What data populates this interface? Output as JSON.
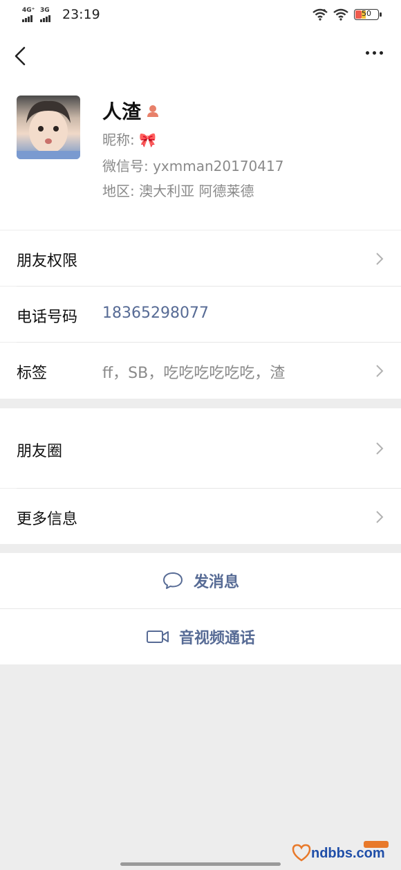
{
  "status": {
    "net1": "4G⁺",
    "net2": "3G",
    "time": "23:19",
    "battery": "50"
  },
  "profile": {
    "name": "人渣",
    "nickname_label": "昵称:",
    "nickname_value": "🎀",
    "wechat_id": "微信号:  yxmman20170417",
    "region": "地区:  澳大利亚  阿德莱德"
  },
  "cells": {
    "permissions": "朋友权限",
    "phone_label": "电话号码",
    "phone_value": "18365298077",
    "tags_label": "标签",
    "tags_value": "ff，SB，吃吃吃吃吃吃，渣",
    "moments": "朋友圈",
    "more_info": "更多信息"
  },
  "actions": {
    "message": "发消息",
    "video_call": "音视频通话"
  },
  "watermark": "ndbbs.com",
  "colors": {
    "link": "#576b95",
    "background": "#ededed",
    "secondary_text": "#8a8a8a"
  }
}
